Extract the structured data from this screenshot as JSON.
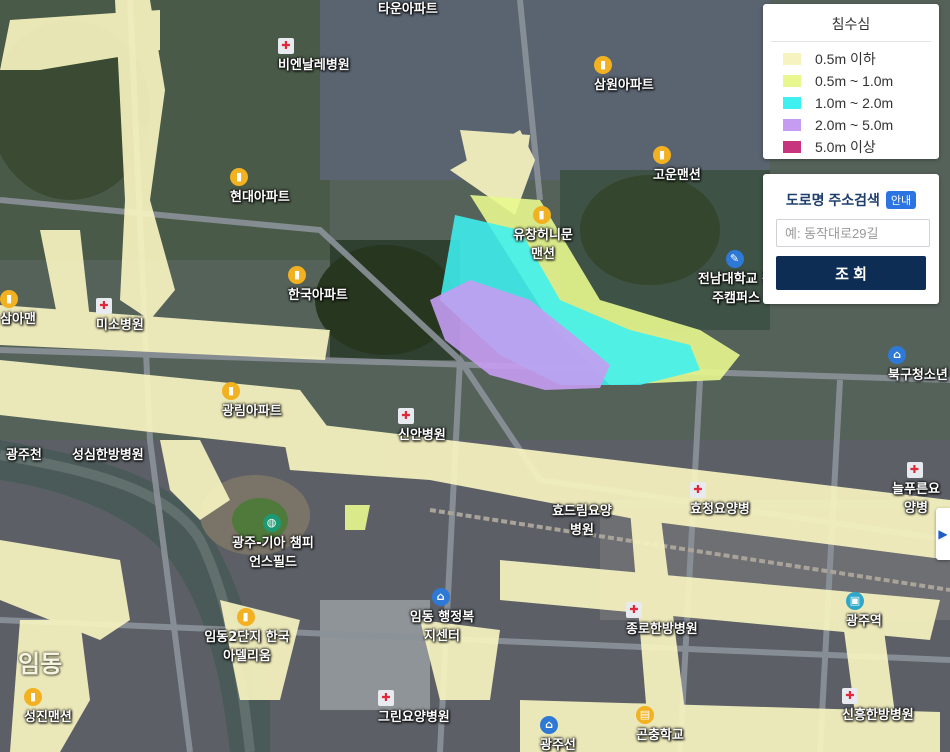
{
  "legend": {
    "title": "침수심",
    "items": [
      {
        "label": "0.5m 이하",
        "color": "#f7f3c0"
      },
      {
        "label": "0.5m ~ 1.0m",
        "color": "#e8f88e"
      },
      {
        "label": "1.0m ~ 2.0m",
        "color": "#3ef0f0"
      },
      {
        "label": "2.0m ~ 5.0m",
        "color": "#c59cf2"
      },
      {
        "label": "5.0m 이상",
        "color": "#c8357f"
      }
    ]
  },
  "search": {
    "title": "도로명 주소검색",
    "guide_label": "안내",
    "placeholder": "예: 동작대로29길",
    "submit_label": "조 회"
  },
  "side_tab": {
    "icon": "chevron-right-icon",
    "glyph": "▶"
  },
  "map_labels": [
    {
      "text": "타운아파트",
      "type": "apartment"
    },
    {
      "text": "비엔날레병원",
      "type": "hospital"
    },
    {
      "text": "삼원아파트",
      "type": "apartment"
    },
    {
      "text": "현대아파트",
      "type": "apartment"
    },
    {
      "text": "고운맨션",
      "type": "apartment"
    },
    {
      "text": "유창허니문맨션",
      "type": "apartment"
    },
    {
      "text": "전남대학교 광주캠퍼스",
      "type": "school"
    },
    {
      "text": "한국아파트",
      "type": "apartment"
    },
    {
      "text": "삼아맨",
      "type": "apartment"
    },
    {
      "text": "미소병원",
      "type": "hospital"
    },
    {
      "text": "북구청소년",
      "type": "public"
    },
    {
      "text": "광림아파트",
      "type": "apartment"
    },
    {
      "text": "신안병원",
      "type": "hospital"
    },
    {
      "text": "광주천",
      "type": "river"
    },
    {
      "text": "성심한방병원",
      "type": "hospital"
    },
    {
      "text": "늘푸른요양병",
      "type": "hospital"
    },
    {
      "text": "효드림요양병원",
      "type": "hospital"
    },
    {
      "text": "효청요양병",
      "type": "hospital"
    },
    {
      "text": "광주-기아 챔피언스필드",
      "type": "stadium"
    },
    {
      "text": "광주역",
      "type": "station"
    },
    {
      "text": "임동",
      "type": "district"
    },
    {
      "text": "임동 행정복지센터",
      "type": "public"
    },
    {
      "text": "임동2단지 한국아델리움",
      "type": "apartment"
    },
    {
      "text": "종로한방병원",
      "type": "hospital"
    },
    {
      "text": "그린요양병원",
      "type": "hospital"
    },
    {
      "text": "성진맨션",
      "type": "apartment"
    },
    {
      "text": "신흥한방병원",
      "type": "hospital"
    },
    {
      "text": "곤충학교",
      "type": "school"
    },
    {
      "text": "광주선",
      "type": "rail"
    }
  ]
}
